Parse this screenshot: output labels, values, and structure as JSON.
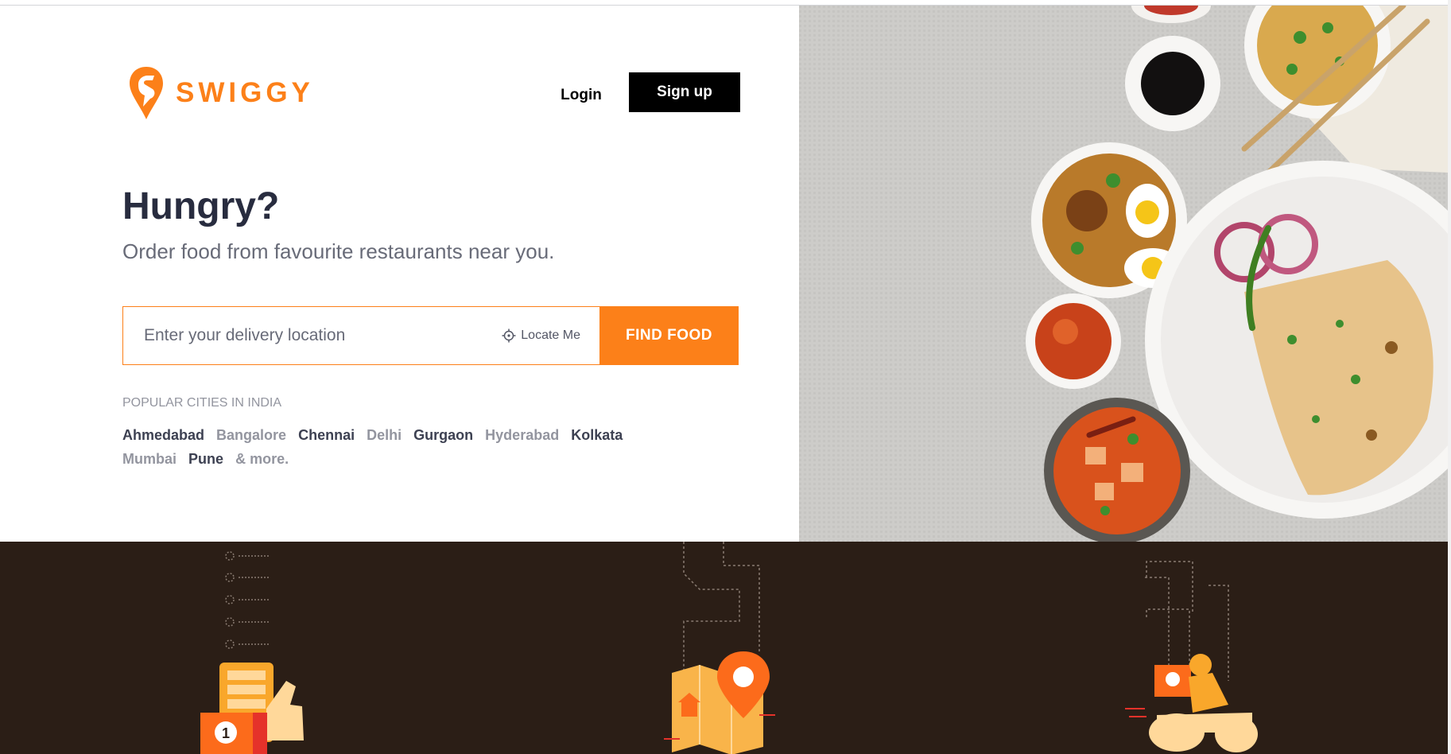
{
  "brand": {
    "name": "SWIGGY",
    "color": "#fc8019"
  },
  "header": {
    "login_label": "Login",
    "signup_label": "Sign up"
  },
  "hero": {
    "headline": "Hungry?",
    "subheadline": "Order food from favourite restaurants near you."
  },
  "search": {
    "placeholder": "Enter your delivery location",
    "value": "",
    "locate_label": "Locate Me",
    "find_label": "FIND FOOD"
  },
  "popular": {
    "title": "POPULAR CITIES IN INDIA",
    "cities": [
      "Ahmedabad",
      "Bangalore",
      "Chennai",
      "Delhi",
      "Gurgaon",
      "Hyderabad",
      "Kolkata",
      "Mumbai",
      "Pune",
      "& more."
    ]
  },
  "icons": {
    "logo": "swiggy-pin-logo",
    "locate": "crosshair-icon",
    "step1": "order-menu-thumbs-up-icon",
    "step2": "map-location-pin-icon",
    "step3": "delivery-scooter-icon"
  },
  "illustration_badge": "1",
  "colors": {
    "accent": "#fc8019",
    "dark_strip": "#2b1e16",
    "text_dark": "#282c3f",
    "text_muted": "#686b78"
  }
}
